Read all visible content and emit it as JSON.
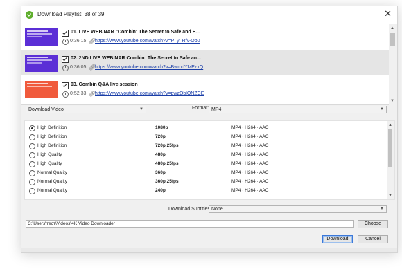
{
  "window": {
    "title": "Download Playlist: 38 of 39",
    "close_glyph": "✕"
  },
  "playlist": {
    "items": [
      {
        "title": "01. LIVE WEBINAR \"Combin: The Secret to Safe and E...",
        "duration": "0:36:15",
        "url": "https://www.youtube.com/watch?v=P_y_Rfv-Ob0",
        "thumb_color": "#5b2fd6",
        "checked": true
      },
      {
        "title": "02. 2ND LIVE WEBINAR Combin: The Secret to Safe an...",
        "duration": "0:36:05",
        "url": "https://www.youtube.com/watch?v=BwmdYIzEzxQ",
        "thumb_color": "#5b2fd6",
        "checked": true
      },
      {
        "title": "03. Combin Q&A live session",
        "duration": "0:52:33",
        "url": "https://www.youtube.com/watch?v=pwzOblONZCE",
        "thumb_color": "#f05a3c",
        "checked": true
      }
    ]
  },
  "options": {
    "download_type": "Download Video",
    "format_label": "Format:",
    "format_value": "MP4"
  },
  "qualities": [
    {
      "name": "High Definition",
      "res": "1080p",
      "codec": "MP4 · H264 · AAC",
      "selected": true
    },
    {
      "name": "High Definition",
      "res": "720p",
      "codec": "MP4 · H264 · AAC",
      "selected": false
    },
    {
      "name": "High Definition",
      "res": "720p 25fps",
      "codec": "MP4 · H264 · AAC",
      "selected": false
    },
    {
      "name": "High Quality",
      "res": "480p",
      "codec": "MP4 · H264 · AAC",
      "selected": false
    },
    {
      "name": "High Quality",
      "res": "480p 25fps",
      "codec": "MP4 · H264 · AAC",
      "selected": false
    },
    {
      "name": "Normal Quality",
      "res": "360p",
      "codec": "MP4 · H264 · AAC",
      "selected": false
    },
    {
      "name": "Normal Quality",
      "res": "360p 25fps",
      "codec": "MP4 · H264 · AAC",
      "selected": false
    },
    {
      "name": "Normal Quality",
      "res": "240p",
      "codec": "MP4 · H264 · AAC",
      "selected": false
    }
  ],
  "subtitles": {
    "label": "Download Subtitles:",
    "value": "None"
  },
  "save_path": {
    "value": "C:\\Users\\тест\\Videos\\4K Video Downloader",
    "choose_label": "Choose"
  },
  "actions": {
    "download_label": "Download",
    "cancel_label": "Cancel"
  },
  "icons": {
    "window": "app-logo-icon",
    "close": "close-icon",
    "duration": "clock-icon",
    "url": "link-icon",
    "dropdown": "chevron-down-icon"
  },
  "colors": {
    "accent": "#3c78d8",
    "link": "#1a3ea8",
    "selected_row": "#e5e5e5"
  }
}
